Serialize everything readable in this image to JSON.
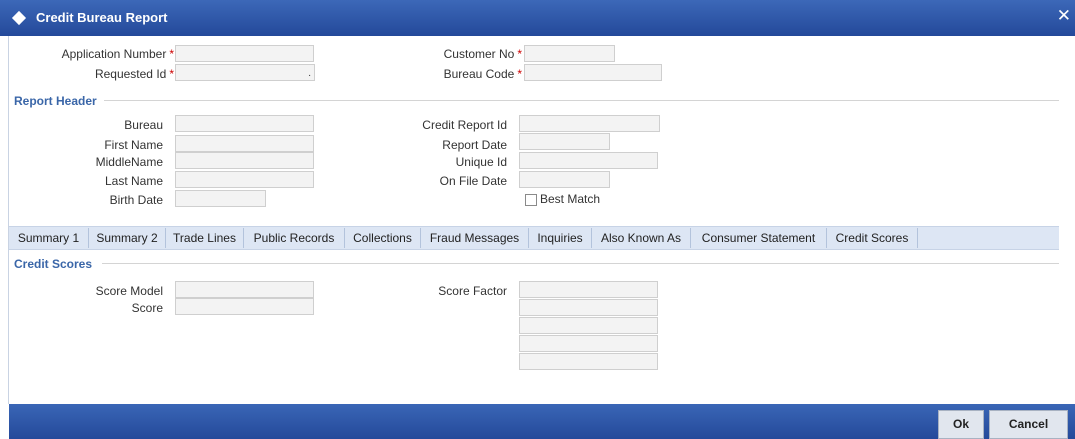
{
  "window": {
    "title": "Credit Bureau Report",
    "close_glyph": "✕"
  },
  "top_form": {
    "application_number_label": "Application Number",
    "requested_id_label": "Requested Id",
    "customer_no_label": "Customer No",
    "bureau_code_label": "Bureau Code",
    "required_marker": "*",
    "application_number_value": "",
    "requested_id_value": "",
    "customer_no_value": "",
    "bureau_code_value": "",
    "requested_id_trailing": "."
  },
  "report_header": {
    "section_title": "Report Header",
    "labels": {
      "bureau": "Bureau",
      "first_name": "First Name",
      "middle_name": "MiddleName",
      "last_name": "Last Name",
      "birth_date": "Birth Date",
      "credit_report_id": "Credit Report Id",
      "report_date": "Report Date",
      "unique_id": "Unique Id",
      "on_file_date": "On File Date",
      "best_match": "Best Match"
    },
    "values": {
      "bureau": "",
      "first_name": "",
      "middle_name": "",
      "last_name": "",
      "birth_date": "",
      "credit_report_id": "",
      "report_date": "",
      "unique_id": "",
      "on_file_date": ""
    },
    "best_match_checked": false
  },
  "tabs": [
    {
      "label": "Summary 1"
    },
    {
      "label": "Summary 2"
    },
    {
      "label": "Trade Lines"
    },
    {
      "label": "Public Records"
    },
    {
      "label": "Collections"
    },
    {
      "label": "Fraud Messages"
    },
    {
      "label": "Inquiries"
    },
    {
      "label": "Also Known As"
    },
    {
      "label": "Consumer Statement"
    },
    {
      "label": "Credit Scores"
    }
  ],
  "credit_scores": {
    "section_title": "Credit Scores",
    "score_model_label": "Score Model",
    "score_label": "Score",
    "score_factor_label": "Score Factor",
    "score_model_value": "",
    "score_value": "",
    "score_factor_values": [
      "",
      "",
      "",
      "",
      ""
    ]
  },
  "footer": {
    "ok_label": "Ok",
    "cancel_label": "Cancel"
  },
  "colors": {
    "title_bar": "#2d58a8",
    "section_title": "#3a66a8",
    "required": "#cc0000",
    "tab_bar": "#dde6f4"
  }
}
